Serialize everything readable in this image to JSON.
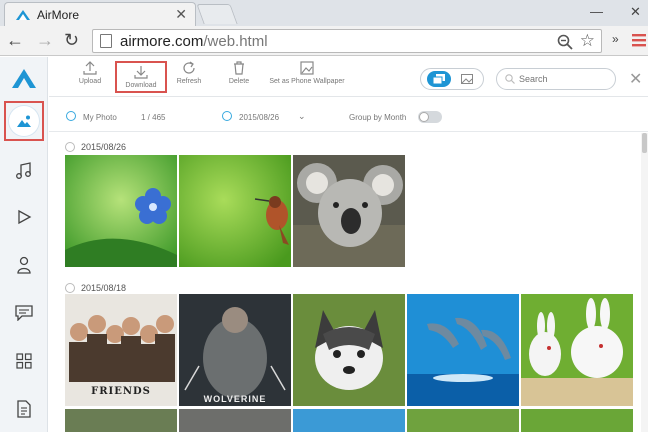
{
  "browser": {
    "tab_title": "AirMore",
    "url_host": "airmore.com",
    "url_path": "/web.html"
  },
  "sidebar": {
    "items": [
      {
        "name": "photos",
        "icon": "photo-icon",
        "active": true
      },
      {
        "name": "music",
        "icon": "music-note-icon"
      },
      {
        "name": "videos",
        "icon": "play-icon"
      },
      {
        "name": "contacts",
        "icon": "person-icon"
      },
      {
        "name": "messages",
        "icon": "message-icon"
      },
      {
        "name": "apps",
        "icon": "grid-icon"
      },
      {
        "name": "documents",
        "icon": "document-icon"
      }
    ]
  },
  "toolbar": {
    "upload": "Upload",
    "download": "Download",
    "refresh": "Refresh",
    "delete": "Delete",
    "wallpaper": "Set as Phone Wallpaper",
    "search_placeholder": "Search"
  },
  "filter": {
    "album": "My Photo",
    "count": "1 / 465",
    "date": "2015/08/26",
    "group_by": "Group by Month"
  },
  "groups": [
    {
      "date": "2015/08/26",
      "photos": [
        "blue flower",
        "hummingbird",
        "koala"
      ]
    },
    {
      "date": "2015/08/18",
      "photos": [
        "friends",
        "wolverine",
        "husky puppy",
        "dolphins",
        "white rabbits"
      ]
    }
  ],
  "photo_captions": {
    "friends": "FRIENDS",
    "wolverine": "WOLVERINE"
  },
  "colors": {
    "accent": "#1e95d4",
    "highlight": "#d9534f"
  }
}
